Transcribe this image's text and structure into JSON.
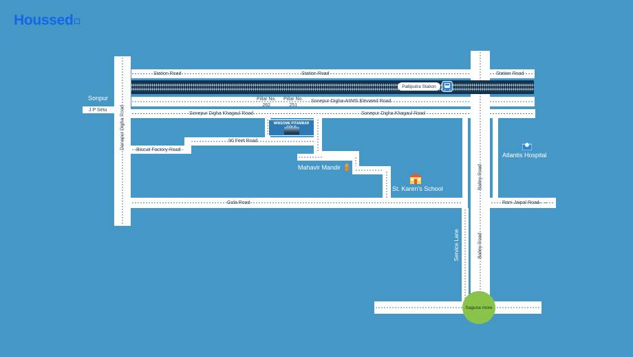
{
  "brand": {
    "logo_text": "Houssed",
    "logo_color": "#1565e8"
  },
  "map": {
    "background_color": "#4597c6",
    "road_color": "#ffffff",
    "roads": [
      {
        "name": "Station Road (left)",
        "label": "Station Road"
      },
      {
        "name": "Station Road (middle)",
        "label": "Station Road"
      },
      {
        "name": "Station Road (right)",
        "label": "Station Road"
      },
      {
        "name": "Sonepur-Digha-AIIMS Elevated Road",
        "label": "Sonepur-Digha-AIIMS Elevated Road"
      },
      {
        "name": "Sonepur Digha Khagaul Road (left)",
        "label": "Sonepur Digha Khagaul Road"
      },
      {
        "name": "Sonepur Digha Khagaul Road (right)",
        "label": "Sonepur Digha Khagaul Road"
      },
      {
        "name": "90 Feet Road",
        "label": "90 Feet Road"
      },
      {
        "name": "Biscuit Factory Road",
        "label": "Biscuit Factory Road"
      },
      {
        "name": "Gola Road",
        "label": "Gola Road"
      },
      {
        "name": "Ram Jaipal Road",
        "label": "Ram Jaipal Road"
      },
      {
        "name": "Danapur Digha Road",
        "label": "Danapur Digha Road"
      },
      {
        "name": "Bailey Road (upper)",
        "label": "Bailey Road"
      },
      {
        "name": "Bailey Road (lower)",
        "label": "Bailey Road"
      },
      {
        "name": "Service Lane",
        "label": "Service Lane"
      },
      {
        "name": "J.P Setu",
        "label": "J.P Setu"
      }
    ],
    "places": {
      "sonpur": "Sonpur",
      "pillar_262": "Pillar No.\n262",
      "pillar_251": "Pillar No.\n251",
      "pillar_262_line1": "Pillar No.",
      "pillar_262_line2": "262",
      "pillar_251_line1": "Pillar No.",
      "pillar_251_line2": "251",
      "station": "Patliputra Station",
      "site": "WINSOME PITAMBAR GOLD",
      "mahavir_mandir": "Mahavir Mandir",
      "school": "St. Karen's School",
      "hospital": "Atlantis Hospital",
      "saguna_more": "Saguna more"
    },
    "icons": {
      "station": "train-icon",
      "temple": "temple-icon",
      "school": "school-icon",
      "hospital": "hospital-icon",
      "landmark": "saguna-circle",
      "saguna_color": "#8ac34a"
    }
  }
}
